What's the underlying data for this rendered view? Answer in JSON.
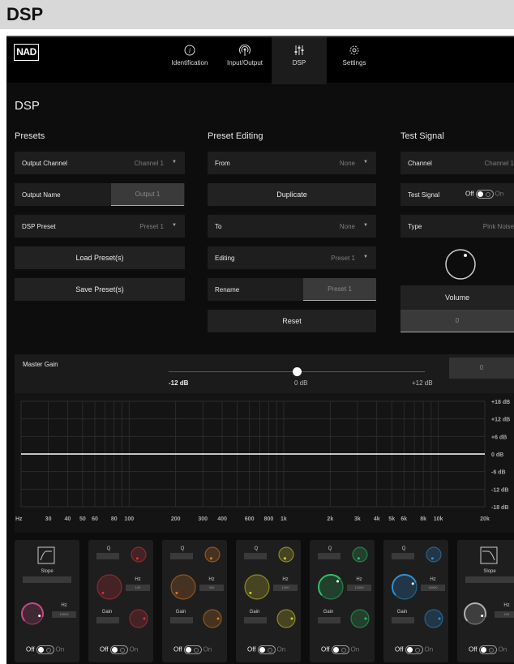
{
  "page_title": "DSP",
  "nav": {
    "logo": "NAD",
    "tabs": [
      {
        "label": "Identification",
        "icon": "info-icon"
      },
      {
        "label": "Input/Output",
        "icon": "antenna-icon"
      },
      {
        "label": "DSP",
        "icon": "sliders-icon",
        "active": true
      },
      {
        "label": "Settings",
        "icon": "gear-icon"
      }
    ]
  },
  "heading": "DSP",
  "presets": {
    "title": "Presets",
    "output_channel_label": "Output Channel",
    "output_channel_value": "Channel 1",
    "output_name_label": "Output Name",
    "output_name_value": "Output 1",
    "dsp_preset_label": "DSP Preset",
    "dsp_preset_value": "Preset 1",
    "load_label": "Load Preset(s)",
    "save_label": "Save Preset(s)"
  },
  "editing": {
    "title": "Preset Editing",
    "from_label": "From",
    "from_value": "None",
    "duplicate_label": "Duplicate",
    "to_label": "To",
    "to_value": "None",
    "editing_label": "Editing",
    "editing_value": "Preset 1",
    "rename_label": "Rename",
    "rename_value": "Preset 1",
    "reset_label": "Reset"
  },
  "test_signal": {
    "title": "Test Signal",
    "channel_label": "Channel",
    "channel_value": "Channel 1",
    "test_label": "Test Signal",
    "off": "Off",
    "on": "On",
    "type_label": "Type",
    "type_value": "Pink Noise",
    "volume_label": "Volume",
    "volume_value": "0"
  },
  "master_gain": {
    "label": "Master Gain",
    "min": "-12 dB",
    "mid": "0 dB",
    "max": "+12 dB",
    "value": "0",
    "level_fraction": 0.5
  },
  "chart_data": {
    "type": "line",
    "title": "",
    "xscale": "log",
    "xlim": [
      20,
      20000
    ],
    "ylim": [
      -18,
      18
    ],
    "x_tick_labels": [
      "Hz",
      "30",
      "40",
      "50",
      "60",
      "80",
      "100",
      "200",
      "300",
      "400",
      "600",
      "800",
      "1k",
      "2k",
      "3k",
      "4k",
      "5k",
      "6k",
      "8k",
      "10k",
      "20k"
    ],
    "y_tick_labels": [
      "+18 dB",
      "+12 dB",
      "+6 dB",
      "0 dB",
      "-6 dB",
      "-12 dB",
      "-18 dB"
    ],
    "series": [
      {
        "values": [
          [
            20,
            0
          ],
          [
            20000,
            0
          ]
        ]
      }
    ],
    "grid": true
  },
  "eq_bands": {
    "highpass": {
      "slope": "Slope",
      "hz": "Hz",
      "hz_value": "15000"
    },
    "peq": [
      {
        "q": "Q",
        "hz": "Hz",
        "gain": "Gain",
        "color": "#d2343b",
        "hz_value": "100"
      },
      {
        "q": "Q",
        "hz": "Hz",
        "gain": "Gain",
        "color": "#d77a2a",
        "hz_value": "300"
      },
      {
        "q": "Q",
        "hz": "Hz",
        "gain": "Gain",
        "color": "#d7cd2f",
        "hz_value": "1000"
      },
      {
        "q": "Q",
        "hz": "Hz",
        "gain": "Gain",
        "color": "#2fbf66",
        "hz_value": "12000"
      },
      {
        "q": "Q",
        "hz": "Hz",
        "gain": "Gain",
        "color": "#2e8fd6",
        "hz_value": "15000"
      }
    ],
    "lowpass": {
      "slope": "Slope",
      "hz": "Hz",
      "hz_value": "100"
    },
    "off": "Off",
    "on": "On",
    "colors": {
      "highpass": "#c64a86",
      "lowpass": "#b0b0b0"
    }
  }
}
